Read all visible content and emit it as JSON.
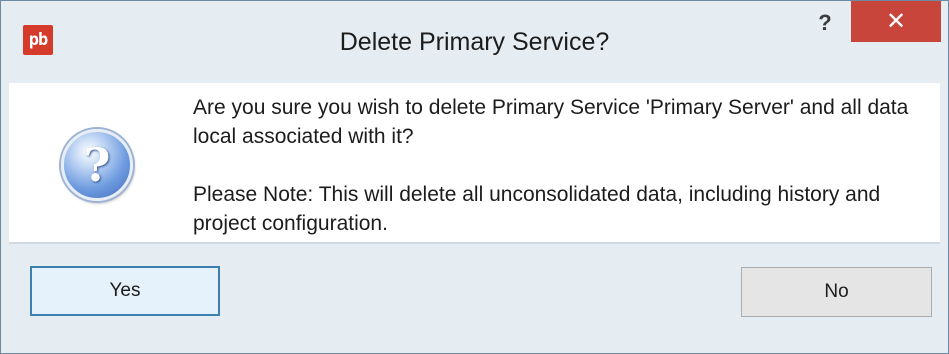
{
  "window": {
    "title": "Delete Primary Service?",
    "app_icon_text": "pb",
    "help_label": "?",
    "close_label": "✕",
    "colors": {
      "close_button": "#c7453a",
      "frame": "#e6edf2",
      "default_button_border": "#3c7fb1"
    }
  },
  "message": {
    "icon": "question-icon",
    "line1": "Are you sure you wish to delete Primary Service 'Primary Server' and all data local associated with it?",
    "line2": "Please Note:  This will delete all unconsolidated data, including history and project configuration."
  },
  "buttons": {
    "yes_label": "Yes",
    "no_label": "No"
  }
}
